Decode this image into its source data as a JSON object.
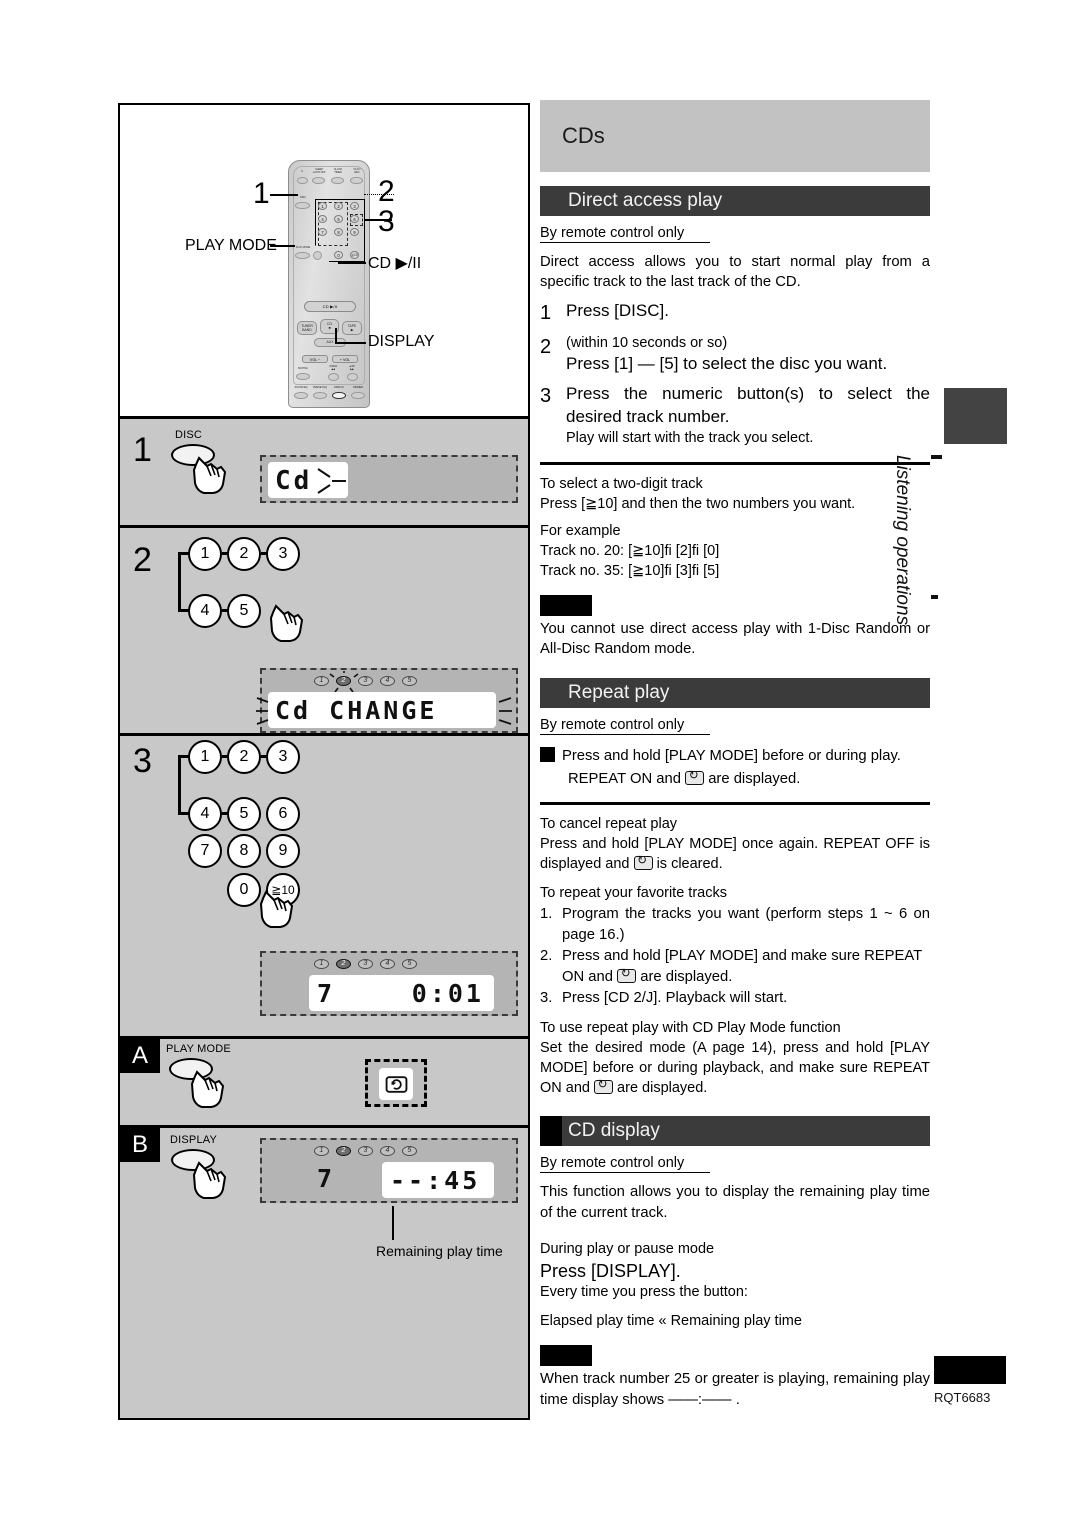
{
  "page": {
    "side_tab_label": "Listening operations",
    "footer_code": "RQT6683"
  },
  "left_panel": {
    "remote": {
      "callouts": {
        "one": "1",
        "two": "2",
        "three": "3",
        "play_mode": "PLAY MODE",
        "cd_play_pause": "CD ▶/II",
        "display": "DISPLAY"
      },
      "top_buttons": [
        {
          "label": "⏻"
        },
        {
          "label": "SLEEP\n-AUTO OFF"
        },
        {
          "label": "CLOCK\nTIMER"
        },
        {
          "label": "PLAY/\nREC"
        }
      ],
      "disc_label": "DISC",
      "play_mode_label": "PLAY MODE",
      "numpad": [
        "1",
        "2",
        "3",
        "4",
        "5",
        "6",
        "7",
        "8",
        "9",
        "0",
        "≧10"
      ],
      "cd_button_label": "CD ▶/II",
      "source_buttons": [
        "TUNER\nBAND",
        "CD\n■",
        "TAPE\n▶"
      ],
      "aux_label": "AUX",
      "vol_down": "VOL −",
      "vol_up": "+ VOL",
      "bottom_row1": [
        "MUTING",
        "▼REW\n◀◀",
        "▲/FF\n▶▶"
      ],
      "bottom_row2": [
        "SOUND EQ",
        "PRESET EQ",
        "DISPLAY",
        "DIMMER"
      ]
    },
    "steps": [
      {
        "num": "1",
        "button_label": "DISC",
        "display": {
          "text": "Cd",
          "blinking": true
        }
      },
      {
        "num": "2",
        "keys": [
          "1",
          "2",
          "3",
          "4",
          "5"
        ],
        "display": {
          "disc_marks": [
            "1",
            "2",
            "3",
            "4",
            "5"
          ],
          "active_disc": "2",
          "text": "Cd  CHANGE",
          "blinking": true
        }
      },
      {
        "num": "3",
        "keys": [
          "1",
          "2",
          "3",
          "4",
          "5",
          "6",
          "7",
          "8",
          "9",
          "0",
          "≧10"
        ],
        "display": {
          "disc_marks": [
            "1",
            "2",
            "3",
            "4",
            "5"
          ],
          "active_disc": "2",
          "track": "7",
          "time": "0:01"
        }
      }
    ],
    "sections": [
      {
        "mark": "A",
        "button_label": "PLAY MODE",
        "icon": "repeat-icon"
      },
      {
        "mark": "B",
        "button_label": "DISPLAY",
        "display": {
          "disc_marks": [
            "1",
            "2",
            "3",
            "4",
            "5"
          ],
          "active_disc": "2",
          "track": "7",
          "time": "--:45"
        },
        "caption": "Remaining play time"
      }
    ]
  },
  "right_column": {
    "banner_title": "CDs",
    "sections": [
      {
        "id": "direct-access-play",
        "title": "Direct access play",
        "black_block": false,
        "by_remote": "By remote control only",
        "intro": "Direct access allows you to start normal play from a specific track to the last track of the CD.",
        "steps": [
          {
            "n": "1",
            "text": "Press [DISC]."
          },
          {
            "n": "2",
            "line1": "(within 10 seconds or so)",
            "line2": "Press [1] — [5] to select the disc you want."
          },
          {
            "n": "3",
            "text": "Press the numeric button(s) to select the desired track number.",
            "sub": "Play will start with the track you select."
          }
        ],
        "after_rule": {
          "heading": "To select a two-digit track",
          "line1": "Press [≧10] and then the two numbers you want.",
          "heading2": "For example",
          "ex1": "Track no. 20: [≧10]fi  [2]fi  [0]",
          "ex2": "Track no. 35: [≧10]fi  [3]fi  [5]"
        },
        "note": "You cannot use direct access play with 1-Disc Random or All-Disc Random mode."
      },
      {
        "id": "repeat-play",
        "title": "Repeat play",
        "black_block": false,
        "by_remote": "By remote control only",
        "bullet": "Press and hold [PLAY MODE] before or during play.",
        "bullet_sub_pre": "REPEAT ON  and",
        "bullet_sub_post": "are displayed.",
        "cancel_heading": "To cancel repeat play",
        "cancel_line_pre": "Press and hold [PLAY MODE] once again.  REPEAT OFF is displayed and",
        "cancel_line_post": "is cleared.",
        "fav_heading": "To repeat your favorite tracks",
        "fav_items": [
          {
            "k": "1.",
            "v": "Program the tracks you want (perform steps 1 ~ 6 on page 16.)"
          },
          {
            "k": "2.",
            "v_pre": "Press and hold [PLAY MODE] and make sure  REPEAT ON  and",
            "v_post": "are displayed."
          },
          {
            "k": "3.",
            "v": "Press [CD 2/J]. Playback will start."
          }
        ],
        "mode_heading": "To use repeat play with CD Play Mode function",
        "mode_pre": "Set the desired mode (A  page 14), press and hold [PLAY MODE] before or during playback, and make sure  REPEAT ON  and",
        "mode_post": "are displayed."
      },
      {
        "id": "cd-display",
        "title": "CD display",
        "black_block": true,
        "by_remote": "By remote control only",
        "intro": "This function allows you to display the remaining play time of the current track.",
        "during": "During play or pause mode",
        "press": "Press [DISPLAY].",
        "every": "Every time you press the button:",
        "toggle": "Elapsed play time «  Remaining play time",
        "note": "When track number 25 or greater is playing, remaining play time display shows ——:—— ."
      }
    ]
  }
}
